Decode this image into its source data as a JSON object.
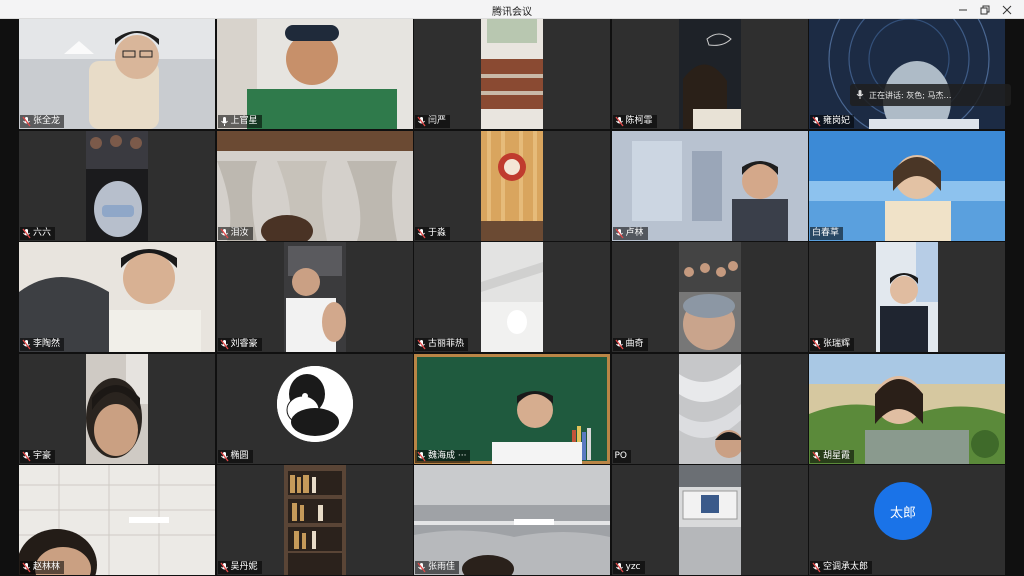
{
  "window": {
    "title": "腾讯会议"
  },
  "window_controls": [
    "minimize-icon",
    "restore-icon",
    "close-icon"
  ],
  "speaking_indicator": {
    "text": "正在讲话: 灰色; 马杰…"
  },
  "participants": [
    {
      "name": "张全龙",
      "mic": "muted"
    },
    {
      "name": "上官星",
      "mic": "active"
    },
    {
      "name": "闫严",
      "mic": "muted"
    },
    {
      "name": "陈柯霏",
      "mic": "muted"
    },
    {
      "name": "雍岗妃",
      "mic": "muted"
    },
    {
      "name": "六六",
      "mic": "muted"
    },
    {
      "name": "泪汝",
      "mic": "muted"
    },
    {
      "name": "于淼",
      "mic": "muted"
    },
    {
      "name": "卢林",
      "mic": "muted"
    },
    {
      "name": "白春草",
      "mic": "none"
    },
    {
      "name": "李陶然",
      "mic": "muted"
    },
    {
      "name": "刘睿豪",
      "mic": "muted"
    },
    {
      "name": "古丽菲热",
      "mic": "muted"
    },
    {
      "name": "曲奇",
      "mic": "muted"
    },
    {
      "name": "张瑞辉",
      "mic": "muted"
    },
    {
      "name": "宇豪",
      "mic": "muted"
    },
    {
      "name": "椭圆",
      "mic": "muted"
    },
    {
      "name": "魏海成 ···",
      "mic": "muted"
    },
    {
      "name": "PO",
      "mic": "none"
    },
    {
      "name": "胡星霞",
      "mic": "muted"
    },
    {
      "name": "赵林林",
      "mic": "muted"
    },
    {
      "name": "吴丹妮",
      "mic": "muted"
    },
    {
      "name": "张雨佳",
      "mic": "muted"
    },
    {
      "name": "yzc",
      "mic": "muted"
    },
    {
      "name": "空调承太郎",
      "mic": "muted"
    }
  ],
  "avatar_initial": "太郎",
  "colors": {
    "avatar_blue": "#1a73e8",
    "tile_bg": "#2f2f2f",
    "mic_muted": "#e04848"
  }
}
